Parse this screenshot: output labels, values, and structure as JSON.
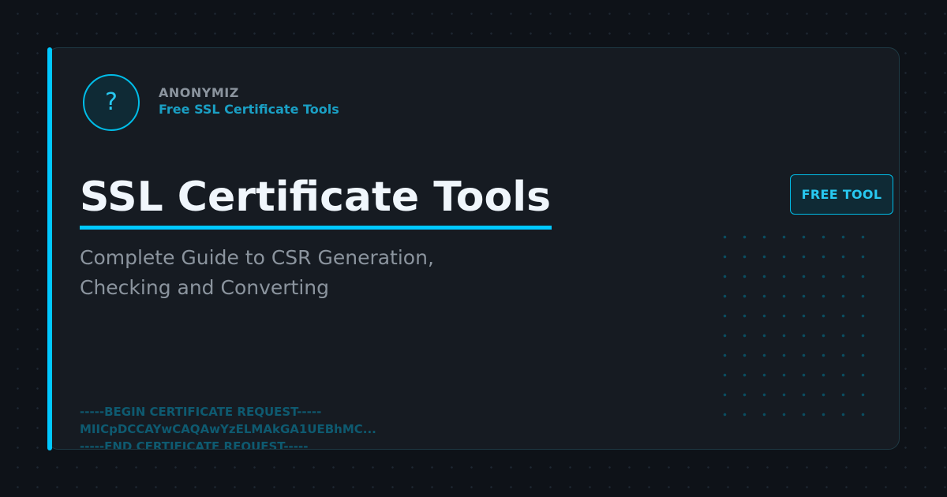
{
  "brand": {
    "icon": "question-mark-icon",
    "icon_glyph": "?",
    "name": "ANONYMIZ",
    "tagline": "Free SSL Certificate Tools"
  },
  "title": "SSL Certificate Tools",
  "subtitle_lines": [
    "Complete Guide to CSR Generation,",
    "Checking and Converting"
  ],
  "badge": "FREE TOOL",
  "csr_snippet": [
    "-----BEGIN CERTIFICATE REQUEST-----",
    "MIICpDCCAYwCAQAwYzELMAkGA1UEBhMC...",
    "-----END CERTIFICATE REQUEST-----"
  ],
  "colors": {
    "background": "#0e1218",
    "card": "#161b22",
    "accent": "#00c8ff",
    "title": "#f0f6fc",
    "muted": "#8b949e",
    "tagline": "#1a9fc4",
    "code": "#0e5a70"
  }
}
